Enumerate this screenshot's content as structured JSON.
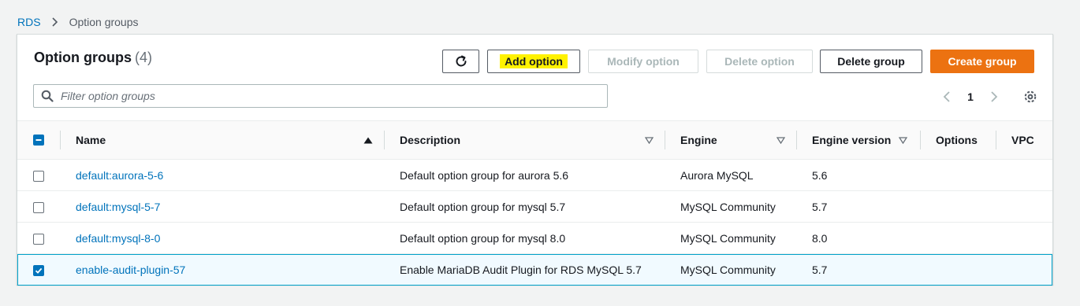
{
  "breadcrumb": {
    "root": "RDS",
    "current": "Option groups"
  },
  "panel": {
    "title": "Option groups",
    "count": "(4)"
  },
  "toolbar": {
    "refresh_icon": "refresh-icon",
    "add_option": "Add option",
    "modify_option": "Modify option",
    "delete_option": "Delete option",
    "delete_group": "Delete group",
    "create_group": "Create group"
  },
  "filter": {
    "placeholder": "Filter option groups",
    "value": ""
  },
  "pagination": {
    "page": "1"
  },
  "table": {
    "columns": {
      "name": "Name",
      "description": "Description",
      "engine": "Engine",
      "engine_version": "Engine version",
      "options": "Options",
      "vpc": "VPC"
    },
    "rows": [
      {
        "name": "default:aurora-5-6",
        "description": "Default option group for aurora 5.6",
        "engine": "Aurora MySQL",
        "engine_version": "5.6",
        "options": "",
        "vpc": "",
        "selected": false
      },
      {
        "name": "default:mysql-5-7",
        "description": "Default option group for mysql 5.7",
        "engine": "MySQL Community",
        "engine_version": "5.7",
        "options": "",
        "vpc": "",
        "selected": false
      },
      {
        "name": "default:mysql-8-0",
        "description": "Default option group for mysql 8.0",
        "engine": "MySQL Community",
        "engine_version": "8.0",
        "options": "",
        "vpc": "",
        "selected": false
      },
      {
        "name": "enable-audit-plugin-57",
        "description": "Enable MariaDB Audit Plugin for RDS MySQL 5.7",
        "engine": "MySQL Community",
        "engine_version": "5.7",
        "options": "",
        "vpc": "",
        "selected": true
      }
    ]
  },
  "colors": {
    "link": "#0073bb",
    "primary_button": "#ec7211",
    "selected_row_border": "#00a1c9",
    "highlight": "#fff200"
  }
}
